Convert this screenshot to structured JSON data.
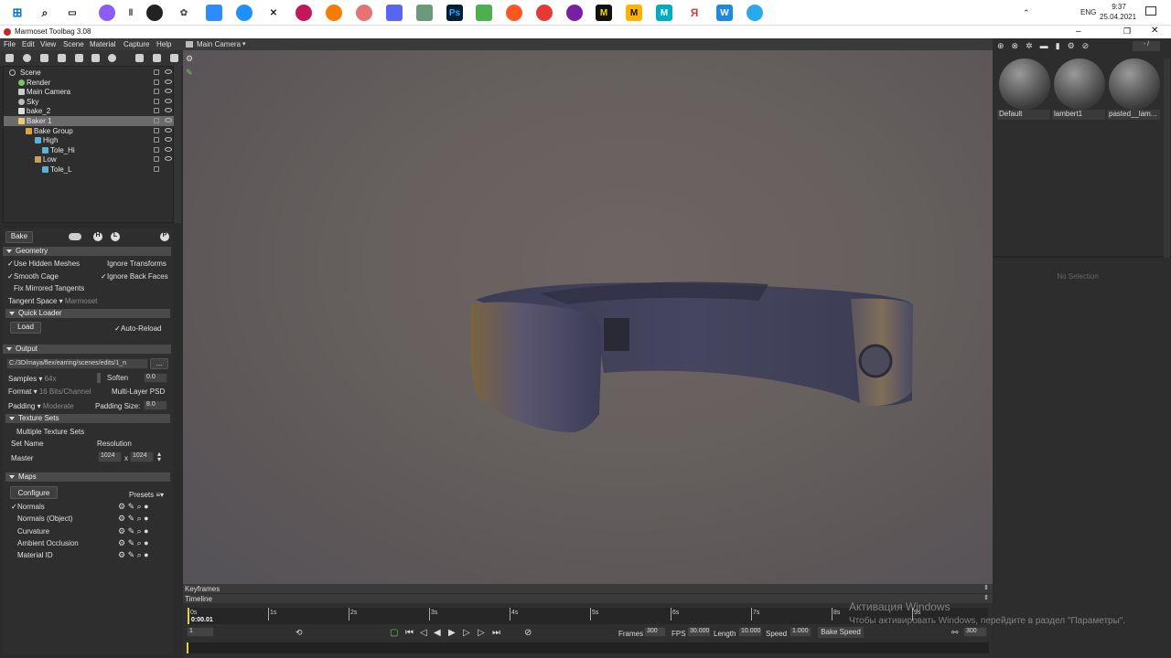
{
  "taskbar": {
    "time": "9:37",
    "date": "25.04.2021",
    "lang": "ENG"
  },
  "window": {
    "title": "Marmoset Toolbag 3.08"
  },
  "menu": [
    "File",
    "Edit",
    "View",
    "Scene",
    "Material",
    "Capture",
    "Help"
  ],
  "viewport": {
    "camera": "Main Camera"
  },
  "scene_tree": [
    {
      "label": "Scene"
    },
    {
      "label": "Render"
    },
    {
      "label": "Main Camera"
    },
    {
      "label": "Sky"
    },
    {
      "label": "bake_2"
    },
    {
      "label": "Baker 1"
    },
    {
      "label": "Bake Group"
    },
    {
      "label": "High"
    },
    {
      "label": "Tole_Hi"
    },
    {
      "label": "Low"
    },
    {
      "label": "Tole_L"
    }
  ],
  "bake": {
    "tab": "Bake",
    "badge_h": "H",
    "badge_l": "L",
    "badge_p": "P",
    "geometry": "Geometry",
    "use_hidden": "Use Hidden Meshes",
    "ignore_transforms": "Ignore Transforms",
    "smooth_cage": "Smooth Cage",
    "ignore_back": "Ignore Back Faces",
    "fix_mirrored": "Fix Mirrored Tangents",
    "tangent_space": "Tangent Space",
    "tangent_value": "Marmoset",
    "quick_loader": "Quick Loader",
    "load": "Load",
    "auto_reload": "Auto-Reload",
    "output": "Output",
    "path": "C:/3D/maya/flex/earring/scenes/edits/1_n",
    "browse": "...",
    "samples": "Samples",
    "samples_val": "64x",
    "soften": "Soften",
    "soften_val": "0.0",
    "format": "Format",
    "format_val": "16 Bits/Channel",
    "multilayer": "Multi-Layer PSD",
    "padding": "Padding",
    "padding_val": "Moderate",
    "padding_size": "Padding Size:",
    "padding_size_val": "8.0",
    "texture_sets": "Texture Sets",
    "multiple_sets": "Multiple Texture Sets",
    "set_name": "Set Name",
    "resolution": "Resolution",
    "master": "Master",
    "res_w": "1024",
    "res_x": "x",
    "res_h": "1024",
    "maps": "Maps",
    "configure": "Configure",
    "presets": "Presets",
    "map_list": [
      "Normals",
      "Normals (Object)",
      "Curvature",
      "Ambient Occlusion",
      "Material ID"
    ]
  },
  "materials": [
    "Default",
    "lambert1",
    "pasted__lam..."
  ],
  "no_selection": "No Selection",
  "timeline": {
    "keyframes": "Keyframes",
    "timeline": "Timeline",
    "current": "0:00.01",
    "ticks": [
      "0s",
      "1s",
      "2s",
      "3s",
      "4s",
      "5s",
      "6s",
      "7s",
      "8s",
      "9s"
    ],
    "frame": "1",
    "frames_label": "Frames",
    "frames": "300",
    "fps_label": "FPS",
    "fps": "30.000",
    "length_label": "Length",
    "length": "10.000",
    "speed_label": "Speed",
    "speed": "1.000",
    "bake_speed": "Bake Speed",
    "end_frame": "300"
  },
  "activation": {
    "line1": "Активация Windows",
    "line2": "Чтобы активировать Windows, перейдите в раздел \"Параметры\"."
  }
}
